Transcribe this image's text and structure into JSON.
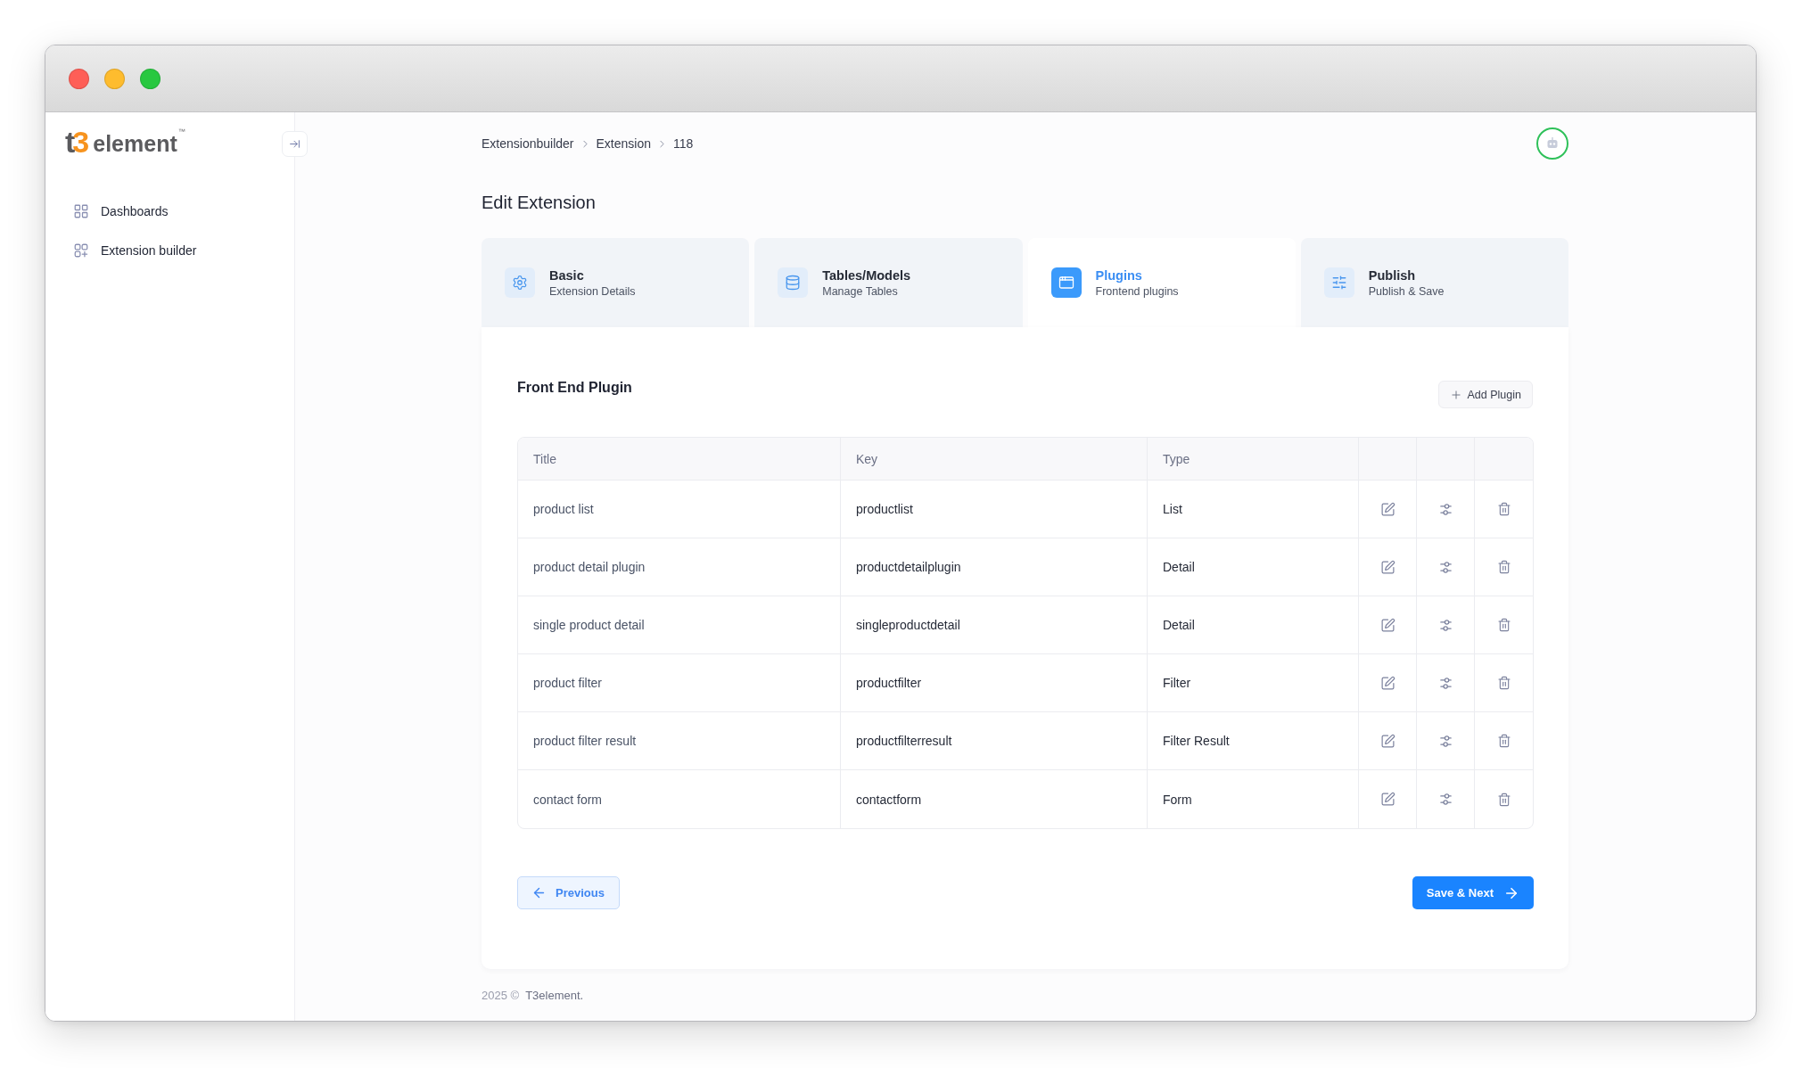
{
  "sidebar": {
    "logo": {
      "mark": "t3",
      "word": "element",
      "trademark": "™"
    },
    "items": [
      {
        "label": "Dashboards",
        "selected": false
      },
      {
        "label": "Extension builder",
        "selected": false
      }
    ]
  },
  "breadcrumb": [
    "Extensionbuilder",
    "Extension",
    "118"
  ],
  "page_title": "Edit Extension",
  "steps": [
    {
      "title": "Basic",
      "subtitle": "Extension Details",
      "selected": false
    },
    {
      "title": "Tables/Models",
      "subtitle": "Manage Tables",
      "selected": false
    },
    {
      "title": "Plugins",
      "subtitle": "Frontend plugins",
      "selected": true
    },
    {
      "title": "Publish",
      "subtitle": "Publish & Save",
      "selected": false
    }
  ],
  "panel": {
    "title": "Front End Plugin",
    "add_button": "Add Plugin",
    "table": {
      "columns": [
        "Title",
        "Key",
        "Type"
      ],
      "rows": [
        {
          "title": "product list",
          "key": "productlist",
          "type": "List"
        },
        {
          "title": "product detail plugin",
          "key": "productdetailplugin",
          "type": "Detail"
        },
        {
          "title": "single product detail",
          "key": "singleproductdetail",
          "type": "Detail"
        },
        {
          "title": "product filter",
          "key": "productfilter",
          "type": "Filter"
        },
        {
          "title": "product filter result",
          "key": "productfilterresult",
          "type": "Filter Result"
        },
        {
          "title": "contact form",
          "key": "contactform",
          "type": "Form"
        }
      ]
    },
    "previous_button": "Previous",
    "next_button": "Save & Next"
  },
  "footer": {
    "copyright": "2025 ©",
    "link": "T3element."
  }
}
